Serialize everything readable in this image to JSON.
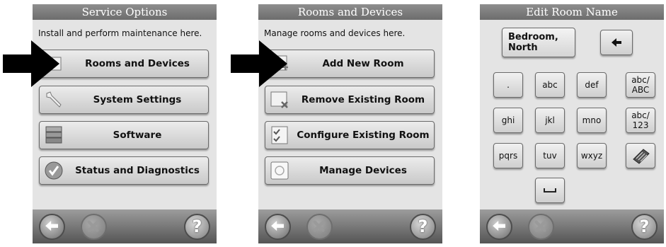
{
  "screens": [
    {
      "title": "Service Options",
      "subtitle": "Install and perform maintenance here.",
      "buttons": [
        {
          "label": "Rooms and Devices",
          "icon": "rooms-icon"
        },
        {
          "label": "System Settings",
          "icon": "wrench-icon"
        },
        {
          "label": "Software",
          "icon": "software-stack-icon"
        },
        {
          "label": "Status and Diagnostics",
          "icon": "checkmark-icon"
        }
      ]
    },
    {
      "title": "Rooms and Devices",
      "subtitle": "Manage rooms and devices here.",
      "buttons": [
        {
          "label": "Add New Room",
          "icon": "add-room-icon"
        },
        {
          "label": "Remove Existing Room",
          "icon": "remove-room-icon"
        },
        {
          "label": "Configure Existing Room",
          "icon": "configure-checklist-icon"
        },
        {
          "label": "Manage Devices",
          "icon": "device-icon"
        }
      ]
    },
    {
      "title": "Edit Room Name",
      "room_name": "Bedroom,\nNorth",
      "keypad": [
        [
          ".",
          "abc",
          "def",
          "abc/\nABC"
        ],
        [
          "ghi",
          "jkl",
          "mno",
          "abc/\n123"
        ],
        [
          "pqrs",
          "tuv",
          "wxyz",
          "keyboard-icon"
        ],
        [
          "␣"
        ]
      ]
    }
  ],
  "bottom_bar": {
    "help_symbol": "?",
    "icons": [
      "back-arrow-icon",
      "cancel-x-icon",
      "help-icon"
    ]
  },
  "callouts": [
    "pointer-arrow-screen-1",
    "pointer-arrow-screen-2"
  ],
  "colors": {
    "title_bar": "#7a7a7a",
    "screen_bg": "#e4e4e4",
    "arrow": "#000000"
  }
}
